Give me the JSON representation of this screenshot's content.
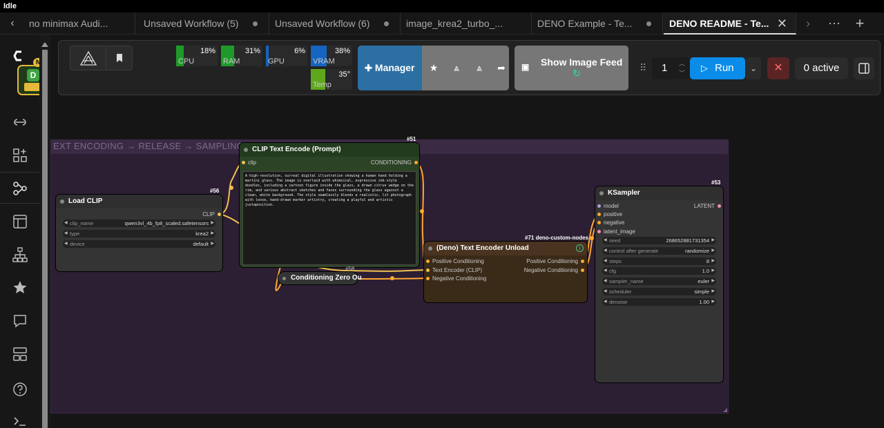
{
  "window": {
    "status": "Idle"
  },
  "tabs": [
    {
      "label": "no minimax Audi...",
      "dirty": false
    },
    {
      "label": "Unsaved Workflow (5)",
      "dirty": true
    },
    {
      "label": "Unsaved Workflow (6)",
      "dirty": true
    },
    {
      "label": "image_krea2_turbo_...",
      "dirty": false
    },
    {
      "label": "DENO Example - Te...",
      "dirty": true
    },
    {
      "label": "DENO README - Te...",
      "active": true
    }
  ],
  "sidebar": {
    "badge": "NEW",
    "logo_letter": "D"
  },
  "monitors": [
    {
      "label": "CPU",
      "value": "18%",
      "fill": 0.18,
      "color": "#1f9a2a"
    },
    {
      "label": "RAM",
      "value": "31%",
      "fill": 0.31,
      "color": "#1f9a2a"
    },
    {
      "label": "GPU",
      "value": "6%",
      "fill": 0.06,
      "color": "#1565c0"
    },
    {
      "label": "VRAM",
      "value": "38%",
      "fill": 0.38,
      "color": "#1565c0"
    },
    {
      "label": "Temp",
      "value": "35°",
      "fill": 0.35,
      "color": "#5fa81c"
    }
  ],
  "toolbar": {
    "manager_label": "Manager",
    "image_feed_label": "Show Image Feed",
    "queue_count": "1",
    "run_label": "Run",
    "active_label": "0 active"
  },
  "group": {
    "title": "EXT ENCODING → RELEASE → SAMPLING",
    "color": "#3a2a44"
  },
  "nodes": {
    "load_clip": {
      "id": "#56",
      "title": "Load CLIP",
      "output": "CLIP",
      "widgets": [
        {
          "label": "clip_name",
          "value": "qwen3vl_4b_fp8_scaled.safetensors"
        },
        {
          "label": "type",
          "value": "krea2"
        },
        {
          "label": "device",
          "value": "default"
        }
      ]
    },
    "clip_encode": {
      "id": "#51",
      "title": "CLIP Text Encode (Prompt)",
      "input": "clip",
      "output": "CONDITIONING",
      "text": "A high-resolution, surreal digital illustration showing a human hand holding a martini glass. The image is overlaid with whimsical, expressive ink-style doodles, including a cartoon figure inside the glass, a drawn citrus wedge on the rim, and various abstract sketches and faces surrounding the glass against a clean, white background. The style seamlessly blends a realistic, lit photograph with loose, hand-drawn marker artistry, creating a playful and artistic juxtaposition."
    },
    "cond_zero": {
      "id": "#58",
      "title": "Conditioning Zero Ou"
    },
    "deno_unload": {
      "id": "#71 deno-custom-nodes",
      "title": "(Deno) Text Encoder Unload",
      "inputs": [
        "Positive Conditioning",
        "Text Encoder (CLIP)",
        "Negative Conditioning"
      ],
      "outputs": [
        "Positive Conditioning",
        "Negative Conditioning"
      ]
    },
    "ksampler": {
      "id": "#53",
      "title": "KSampler",
      "inputs": [
        "model",
        "positive",
        "negative",
        "latent_image"
      ],
      "output": "LATENT",
      "widgets": [
        {
          "label": "seed",
          "value": "268652881731354"
        },
        {
          "label": "control after generate",
          "value": "randomize"
        },
        {
          "label": "steps",
          "value": "8"
        },
        {
          "label": "cfg",
          "value": "1.0"
        },
        {
          "label": "sampler_name",
          "value": "euler"
        },
        {
          "label": "scheduler",
          "value": "simple"
        },
        {
          "label": "denoise",
          "value": "1.00"
        }
      ]
    }
  }
}
